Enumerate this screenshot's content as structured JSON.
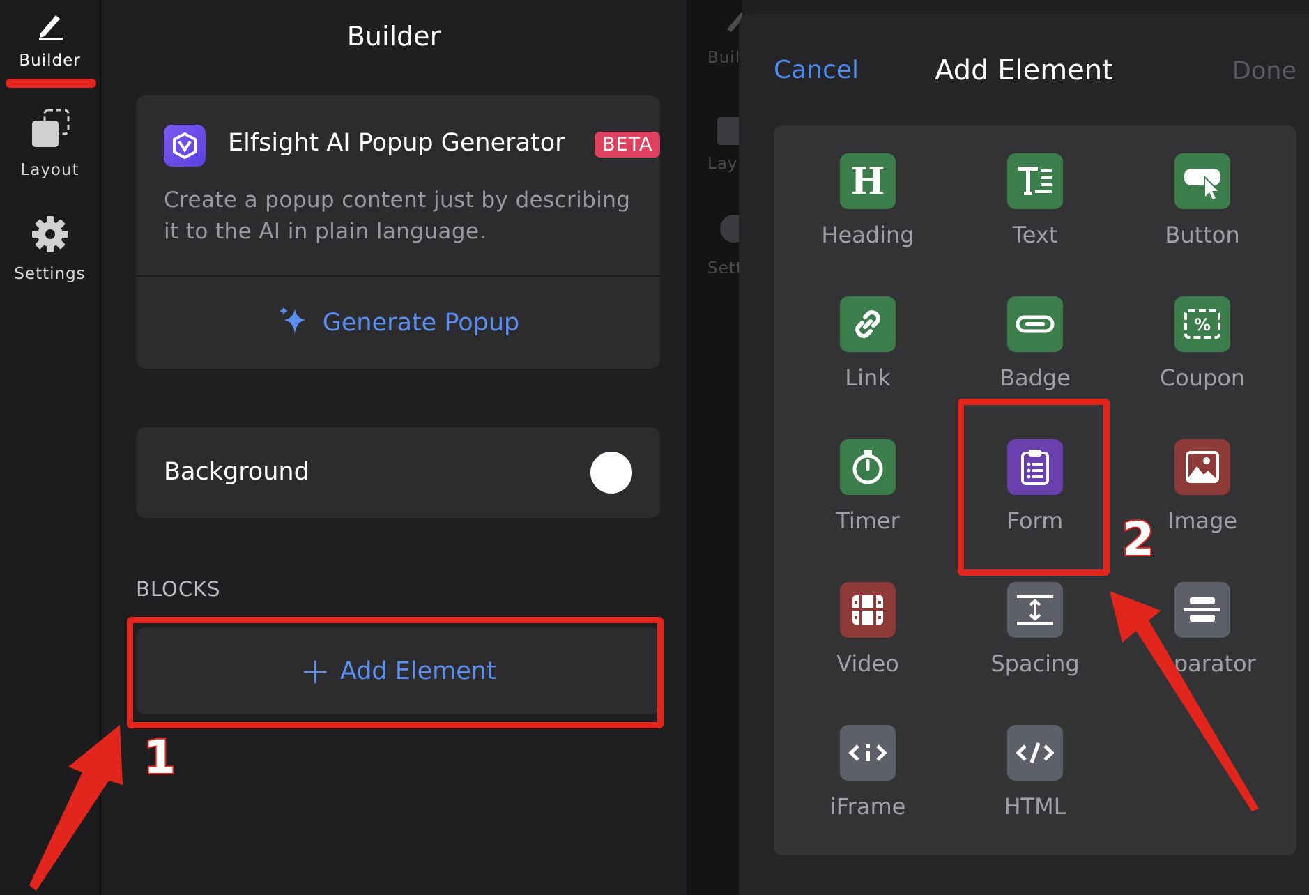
{
  "sidebar": {
    "items": [
      {
        "label": "Builder",
        "icon": "pencil-icon",
        "active": true
      },
      {
        "label": "Layout",
        "icon": "layout-icon"
      },
      {
        "label": "Settings",
        "icon": "gear-icon"
      }
    ]
  },
  "builder": {
    "title": "Builder",
    "ai_card": {
      "title": "Elfsight AI Popup Generator",
      "badge": "BETA",
      "description": "Create a popup content just by describing it to the AI in plain language.",
      "button": "Generate Popup"
    },
    "background": {
      "label": "Background",
      "toggle_on": false
    },
    "blocks_label": "BLOCKS",
    "add_element": "Add Element"
  },
  "background_sidebar": {
    "builder": "Buil",
    "layout": "Lay",
    "settings": "Sett"
  },
  "modal": {
    "cancel": "Cancel",
    "title": "Add Element",
    "done": "Done",
    "elements": [
      {
        "label": "Heading",
        "icon": "heading-icon",
        "color": "#3b7e4c"
      },
      {
        "label": "Text",
        "icon": "text-icon",
        "color": "#3b7e4c"
      },
      {
        "label": "Button",
        "icon": "button-icon",
        "color": "#3b7e4c"
      },
      {
        "label": "Link",
        "icon": "link-icon",
        "color": "#3b7e4c"
      },
      {
        "label": "Badge",
        "icon": "badge-icon",
        "color": "#3b7e4c"
      },
      {
        "label": "Coupon",
        "icon": "coupon-icon",
        "color": "#3b7e4c"
      },
      {
        "label": "Timer",
        "icon": "timer-icon",
        "color": "#3b7e4c"
      },
      {
        "label": "Form",
        "icon": "form-icon",
        "color": "#6a3fae"
      },
      {
        "label": "Image",
        "icon": "image-icon",
        "color": "#8e3a38"
      },
      {
        "label": "Video",
        "icon": "video-icon",
        "color": "#8e3a38"
      },
      {
        "label": "Spacing",
        "icon": "spacing-icon",
        "color": "#5d6068"
      },
      {
        "label": "eparator",
        "icon": "separator-icon",
        "color": "#5d6068"
      },
      {
        "label": "iFrame",
        "icon": "iframe-icon",
        "color": "#5d6068"
      },
      {
        "label": "HTML",
        "icon": "html-icon",
        "color": "#5d6068"
      }
    ]
  },
  "annotations": {
    "step1": "1",
    "step2": "2",
    "highlight_color": "#e2251d"
  }
}
